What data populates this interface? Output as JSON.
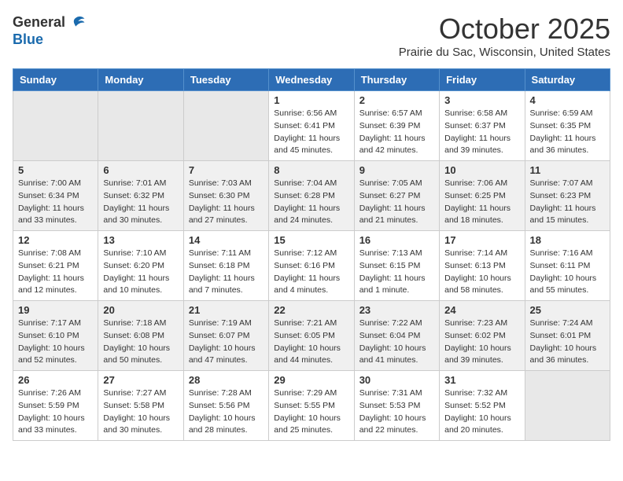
{
  "header": {
    "logo_general": "General",
    "logo_blue": "Blue",
    "month_title": "October 2025",
    "location": "Prairie du Sac, Wisconsin, United States"
  },
  "days_of_week": [
    "Sunday",
    "Monday",
    "Tuesday",
    "Wednesday",
    "Thursday",
    "Friday",
    "Saturday"
  ],
  "weeks": [
    [
      {
        "day": "",
        "info": ""
      },
      {
        "day": "",
        "info": ""
      },
      {
        "day": "",
        "info": ""
      },
      {
        "day": "1",
        "info": "Sunrise: 6:56 AM\nSunset: 6:41 PM\nDaylight: 11 hours and 45 minutes."
      },
      {
        "day": "2",
        "info": "Sunrise: 6:57 AM\nSunset: 6:39 PM\nDaylight: 11 hours and 42 minutes."
      },
      {
        "day": "3",
        "info": "Sunrise: 6:58 AM\nSunset: 6:37 PM\nDaylight: 11 hours and 39 minutes."
      },
      {
        "day": "4",
        "info": "Sunrise: 6:59 AM\nSunset: 6:35 PM\nDaylight: 11 hours and 36 minutes."
      }
    ],
    [
      {
        "day": "5",
        "info": "Sunrise: 7:00 AM\nSunset: 6:34 PM\nDaylight: 11 hours and 33 minutes."
      },
      {
        "day": "6",
        "info": "Sunrise: 7:01 AM\nSunset: 6:32 PM\nDaylight: 11 hours and 30 minutes."
      },
      {
        "day": "7",
        "info": "Sunrise: 7:03 AM\nSunset: 6:30 PM\nDaylight: 11 hours and 27 minutes."
      },
      {
        "day": "8",
        "info": "Sunrise: 7:04 AM\nSunset: 6:28 PM\nDaylight: 11 hours and 24 minutes."
      },
      {
        "day": "9",
        "info": "Sunrise: 7:05 AM\nSunset: 6:27 PM\nDaylight: 11 hours and 21 minutes."
      },
      {
        "day": "10",
        "info": "Sunrise: 7:06 AM\nSunset: 6:25 PM\nDaylight: 11 hours and 18 minutes."
      },
      {
        "day": "11",
        "info": "Sunrise: 7:07 AM\nSunset: 6:23 PM\nDaylight: 11 hours and 15 minutes."
      }
    ],
    [
      {
        "day": "12",
        "info": "Sunrise: 7:08 AM\nSunset: 6:21 PM\nDaylight: 11 hours and 12 minutes."
      },
      {
        "day": "13",
        "info": "Sunrise: 7:10 AM\nSunset: 6:20 PM\nDaylight: 11 hours and 10 minutes."
      },
      {
        "day": "14",
        "info": "Sunrise: 7:11 AM\nSunset: 6:18 PM\nDaylight: 11 hours and 7 minutes."
      },
      {
        "day": "15",
        "info": "Sunrise: 7:12 AM\nSunset: 6:16 PM\nDaylight: 11 hours and 4 minutes."
      },
      {
        "day": "16",
        "info": "Sunrise: 7:13 AM\nSunset: 6:15 PM\nDaylight: 11 hours and 1 minute."
      },
      {
        "day": "17",
        "info": "Sunrise: 7:14 AM\nSunset: 6:13 PM\nDaylight: 10 hours and 58 minutes."
      },
      {
        "day": "18",
        "info": "Sunrise: 7:16 AM\nSunset: 6:11 PM\nDaylight: 10 hours and 55 minutes."
      }
    ],
    [
      {
        "day": "19",
        "info": "Sunrise: 7:17 AM\nSunset: 6:10 PM\nDaylight: 10 hours and 52 minutes."
      },
      {
        "day": "20",
        "info": "Sunrise: 7:18 AM\nSunset: 6:08 PM\nDaylight: 10 hours and 50 minutes."
      },
      {
        "day": "21",
        "info": "Sunrise: 7:19 AM\nSunset: 6:07 PM\nDaylight: 10 hours and 47 minutes."
      },
      {
        "day": "22",
        "info": "Sunrise: 7:21 AM\nSunset: 6:05 PM\nDaylight: 10 hours and 44 minutes."
      },
      {
        "day": "23",
        "info": "Sunrise: 7:22 AM\nSunset: 6:04 PM\nDaylight: 10 hours and 41 minutes."
      },
      {
        "day": "24",
        "info": "Sunrise: 7:23 AM\nSunset: 6:02 PM\nDaylight: 10 hours and 39 minutes."
      },
      {
        "day": "25",
        "info": "Sunrise: 7:24 AM\nSunset: 6:01 PM\nDaylight: 10 hours and 36 minutes."
      }
    ],
    [
      {
        "day": "26",
        "info": "Sunrise: 7:26 AM\nSunset: 5:59 PM\nDaylight: 10 hours and 33 minutes."
      },
      {
        "day": "27",
        "info": "Sunrise: 7:27 AM\nSunset: 5:58 PM\nDaylight: 10 hours and 30 minutes."
      },
      {
        "day": "28",
        "info": "Sunrise: 7:28 AM\nSunset: 5:56 PM\nDaylight: 10 hours and 28 minutes."
      },
      {
        "day": "29",
        "info": "Sunrise: 7:29 AM\nSunset: 5:55 PM\nDaylight: 10 hours and 25 minutes."
      },
      {
        "day": "30",
        "info": "Sunrise: 7:31 AM\nSunset: 5:53 PM\nDaylight: 10 hours and 22 minutes."
      },
      {
        "day": "31",
        "info": "Sunrise: 7:32 AM\nSunset: 5:52 PM\nDaylight: 10 hours and 20 minutes."
      },
      {
        "day": "",
        "info": ""
      }
    ]
  ]
}
